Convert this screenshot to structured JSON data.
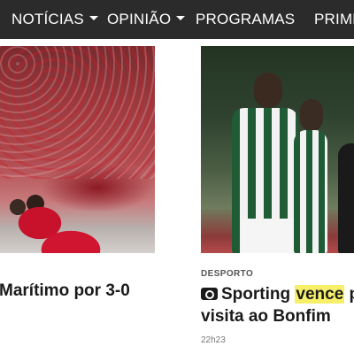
{
  "nav": {
    "items": [
      {
        "label": "NOTÍCIAS",
        "dropdown": true
      },
      {
        "label": "OPINIÃO",
        "dropdown": true
      },
      {
        "label": "PROGRAMAS",
        "dropdown": false
      },
      {
        "label": "PRIME",
        "dropdown": false
      }
    ]
  },
  "articles": [
    {
      "headline": "Marítimo por 3-0"
    },
    {
      "category": "DESPORTO",
      "headline_pre": "Sporting ",
      "headline_highlight": "vence",
      "headline_mid": " po",
      "headline_line2": "visita ao Bonfim",
      "time": "22h23",
      "media_icon": "camera-icon"
    }
  ],
  "colors": {
    "navbar_bg": "#2b2b2b",
    "highlight": "#f6ef6a"
  }
}
